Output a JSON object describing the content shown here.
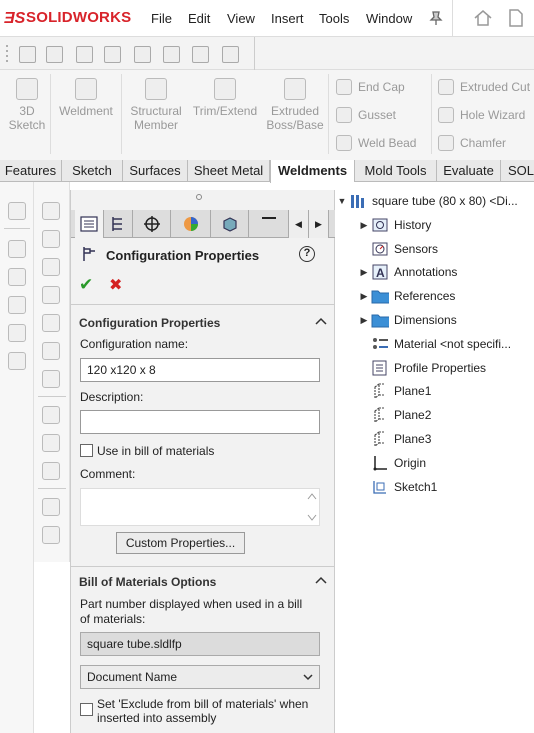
{
  "app": {
    "logo_prefix": "3S",
    "logo_name": "SOLIDWORKS"
  },
  "menu": [
    "File",
    "Edit",
    "View",
    "Insert",
    "Tools",
    "Window"
  ],
  "command_manager": {
    "buttons": [
      {
        "label": "3D\nSketch"
      },
      {
        "label": "Weldment"
      },
      {
        "label": "Structural\nMember"
      },
      {
        "label": "Trim/Extend"
      },
      {
        "label": "Extruded\nBoss/Base"
      }
    ],
    "small_buttons_col1": [
      "End Cap",
      "Gusset",
      "Weld Bead"
    ],
    "small_buttons_col2": [
      "Extruded Cut",
      "Hole Wizard",
      "Chamfer"
    ]
  },
  "tabs": [
    "Features",
    "Sketch",
    "Surfaces",
    "Sheet Metal",
    "Weldments",
    "Mold Tools",
    "Evaluate",
    "SOL"
  ],
  "active_tab": "Weldments",
  "property_manager": {
    "title": "Configuration Properties",
    "help": "?",
    "ok": "✔",
    "cancel": "✖",
    "config_section": {
      "header": "Configuration Properties",
      "name_label": "Configuration name:",
      "name_value": "120 x120 x 8",
      "description_label": "Description:",
      "description_value": "",
      "use_in_bom_label": "Use in bill of materials",
      "comment_label": "Comment:",
      "custom_props_button": "Custom Properties..."
    },
    "bom_section": {
      "header": "Bill of Materials Options",
      "part_number_label": "Part number displayed when used in a bill of materials:",
      "part_number_value": "square tube.sldlfp",
      "dropdown_value": "Document Name",
      "exclude_label": "Set 'Exclude from bill of materials' when inserted into assembly"
    }
  },
  "tree": {
    "root": "square tube (80 x 80) <Di...",
    "items": [
      {
        "label": "History",
        "expandable": true,
        "icon": "history-icon"
      },
      {
        "label": "Sensors",
        "expandable": false,
        "icon": "sensors-icon"
      },
      {
        "label": "Annotations",
        "expandable": true,
        "icon": "annotations-icon"
      },
      {
        "label": "References",
        "expandable": true,
        "icon": "folder-icon"
      },
      {
        "label": "Dimensions",
        "expandable": true,
        "icon": "folder-icon"
      },
      {
        "label": "Material <not specifi...",
        "expandable": false,
        "icon": "material-icon"
      },
      {
        "label": "Profile Properties",
        "expandable": false,
        "icon": "profile-properties-icon"
      },
      {
        "label": "Plane1",
        "expandable": false,
        "icon": "plane-icon"
      },
      {
        "label": "Plane2",
        "expandable": false,
        "icon": "plane-icon"
      },
      {
        "label": "Plane3",
        "expandable": false,
        "icon": "plane-icon"
      },
      {
        "label": "Origin",
        "expandable": false,
        "icon": "origin-icon"
      },
      {
        "label": "Sketch1",
        "expandable": false,
        "icon": "sketch-icon"
      }
    ]
  },
  "colors": {
    "brand": "#d8232a",
    "folder": "#3b8fd6",
    "ok": "#2a9a2a",
    "cancel": "#d42020"
  }
}
